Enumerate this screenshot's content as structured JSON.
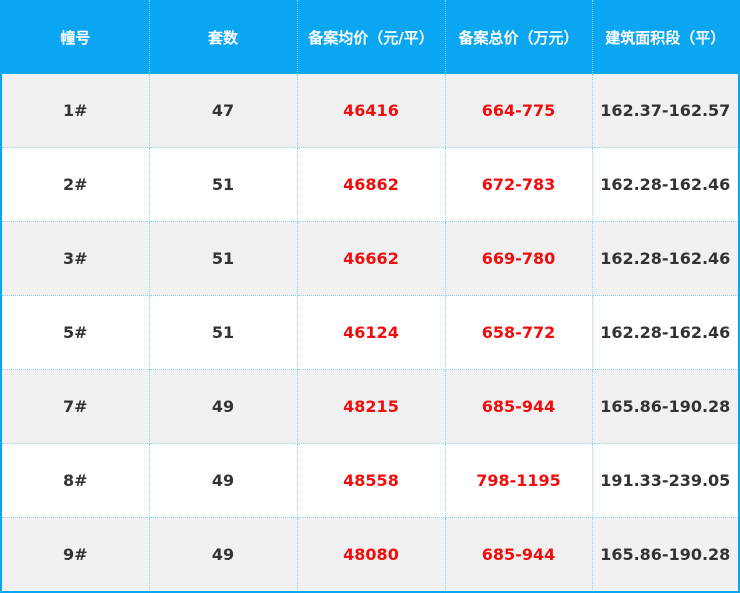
{
  "table": {
    "headers": [
      "幢号",
      "套数",
      "备案均价（元/平）",
      "备案总价（万元）",
      "建筑面积段（平）"
    ],
    "rows": [
      [
        "1#",
        "47",
        "46416",
        "664-775",
        "162.37-162.57"
      ],
      [
        "2#",
        "51",
        "46862",
        "672-783",
        "162.28-162.46"
      ],
      [
        "3#",
        "51",
        "46662",
        "669-780",
        "162.28-162.46"
      ],
      [
        "5#",
        "51",
        "46124",
        "658-772",
        "162.28-162.46"
      ],
      [
        "7#",
        "49",
        "48215",
        "685-944",
        "165.86-190.28"
      ],
      [
        "8#",
        "49",
        "48558",
        "798-1195",
        "191.33-239.05"
      ],
      [
        "9#",
        "49",
        "48080",
        "685-944",
        "165.86-190.28"
      ]
    ]
  },
  "colors": {
    "header_bg": "#0aa6f2",
    "header_text": "#ffffff",
    "highlight_text": "#f20c0c",
    "body_text": "#333333",
    "stripe": "#f1f1f1"
  }
}
